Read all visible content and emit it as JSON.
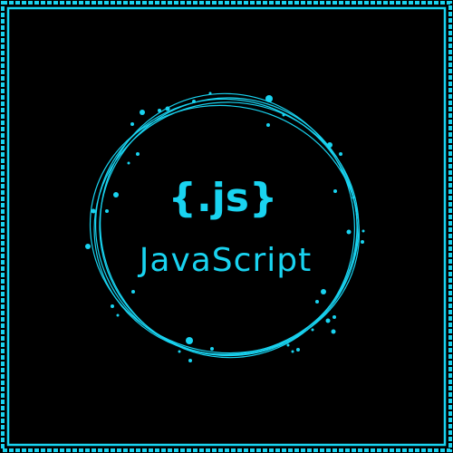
{
  "logo": {
    "mark_text": "{.js}",
    "word_text": "JavaScript",
    "accent_color": "#19d3f0",
    "background_color": "#000000"
  },
  "icons": {
    "frame": "dashed-border-frame",
    "ring": "scribbled-circle-ring",
    "dots": "scattered-dots"
  }
}
